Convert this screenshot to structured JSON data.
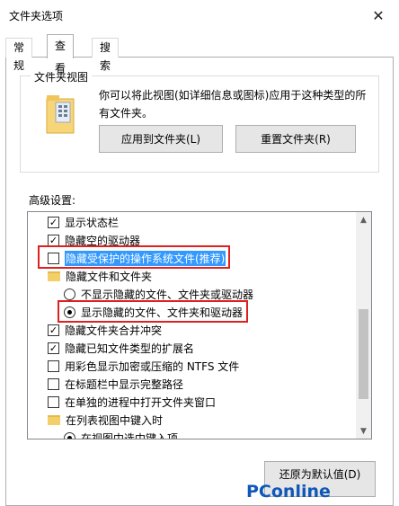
{
  "window": {
    "title": "文件夹选项",
    "close_glyph": "✕"
  },
  "tabs": [
    {
      "label": "常规",
      "active": false
    },
    {
      "label": "查看",
      "active": true
    },
    {
      "label": "搜索",
      "active": false
    }
  ],
  "folder_views": {
    "legend": "文件夹视图",
    "description": "你可以将此视图(如详细信息或图标)应用于这种类型的所有文件夹。",
    "apply_button": "应用到文件夹(L)",
    "reset_button": "重置文件夹(R)"
  },
  "advanced": {
    "label": "高级设置:",
    "items": [
      {
        "type": "checkbox",
        "checked": true,
        "label": "显示状态栏"
      },
      {
        "type": "checkbox",
        "checked": true,
        "label": "隐藏空的驱动器"
      },
      {
        "type": "checkbox",
        "checked": false,
        "label": "隐藏受保护的操作系统文件(推荐)",
        "selected": true,
        "outlined": true
      },
      {
        "type": "folder",
        "label": "隐藏文件和文件夹"
      },
      {
        "type": "radio",
        "checked": false,
        "label": "不显示隐藏的文件、文件夹或驱动器"
      },
      {
        "type": "radio",
        "checked": true,
        "label": "显示隐藏的文件、文件夹和驱动器",
        "outlined": true
      },
      {
        "type": "checkbox",
        "checked": true,
        "label": "隐藏文件夹合并冲突"
      },
      {
        "type": "checkbox",
        "checked": true,
        "label": "隐藏已知文件类型的扩展名"
      },
      {
        "type": "checkbox",
        "checked": false,
        "label": "用彩色显示加密或压缩的 NTFS 文件"
      },
      {
        "type": "checkbox",
        "checked": false,
        "label": "在标题栏中显示完整路径"
      },
      {
        "type": "checkbox",
        "checked": false,
        "label": "在单独的进程中打开文件夹窗口"
      },
      {
        "type": "folder",
        "label": "在列表视图中键入时"
      },
      {
        "type": "radio",
        "checked": true,
        "label": "在视图中选中键入项"
      }
    ],
    "restore_button": "还原为默认值(D)"
  },
  "watermark": "PConline",
  "colors": {
    "selection": "#3399ff",
    "highlight_box": "#e02020",
    "folder": "#f3cf6a"
  }
}
